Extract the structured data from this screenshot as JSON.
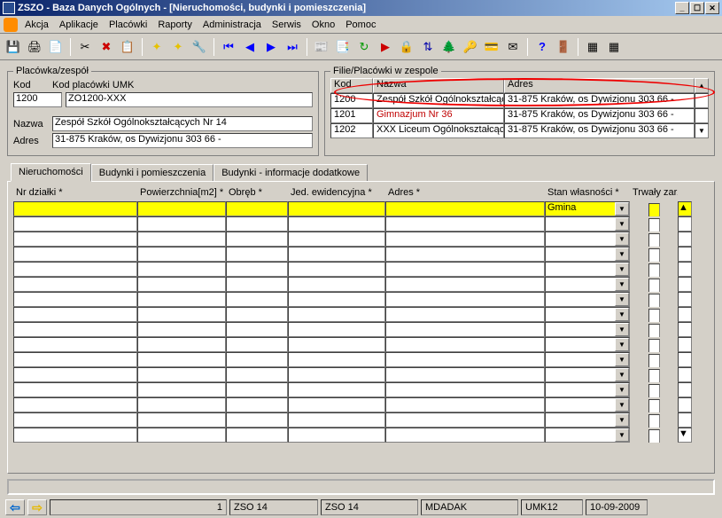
{
  "title": "ZSZO - Baza Danych Ogólnych - [Nieruchomości, budynki i pomieszczenia]",
  "menu": {
    "m1": "Akcja",
    "m2": "Aplikacje",
    "m3": "Placówki",
    "m4": "Raporty",
    "m5": "Administracja",
    "m6": "Serwis",
    "m7": "Okno",
    "m8": "Pomoc"
  },
  "groupbox": {
    "left_legend": "Placówka/zespół",
    "right_legend": "Filie/Placówki w zespole",
    "kod_label": "Kod",
    "umk_label": "Kod placówki UMK",
    "nazwa_label": "Nazwa",
    "adres_label": "Adres",
    "kod_value": "1200",
    "umk_value": "ZO1200-XXX",
    "nazwa_value": "Zespół Szkół Ogólnokształcących Nr 14",
    "adres_value": "31-875 Kraków, os Dywizjonu 303 66 -"
  },
  "filie": {
    "h_kod": "Kod",
    "h_nazwa": "Nazwa",
    "h_adres": "Adres",
    "rows": [
      {
        "kod": "1200",
        "nazwa": "Zespół Szkół Ogólnokształcąc",
        "adres": "31-875 Kraków, os Dywizjonu 303 66 -"
      },
      {
        "kod": "1201",
        "nazwa": "Gimnazjum Nr 36",
        "adres": "31-875 Kraków, os Dywizjonu 303 66 -"
      },
      {
        "kod": "1202",
        "nazwa": "XXX Liceum Ogólnokształcące",
        "adres": "31-875 Kraków, os Dywizjonu 303 66 -"
      }
    ]
  },
  "tabs": {
    "t1": "Nieruchomości",
    "t2": "Budynki i pomieszczenia",
    "t3": "Budynki - informacje dodatkowe"
  },
  "grid": {
    "h1": "Nr działki *",
    "h2": "Powierzchnia[m2] *",
    "h3": "Obręb *",
    "h4": "Jed. ewidencyjna *",
    "h5": "Adres *",
    "h6": "Stan własności *",
    "h7": "Trwały zarząd",
    "first_stan": "Gmina"
  },
  "status": {
    "count": "1",
    "s1": "ZSO 14",
    "s2": "ZSO 14",
    "s3": "MDADAK",
    "s4": "UMK12",
    "date": "10-09-2009"
  },
  "win": {
    "min": "_",
    "max": "☐",
    "close": "✕"
  }
}
